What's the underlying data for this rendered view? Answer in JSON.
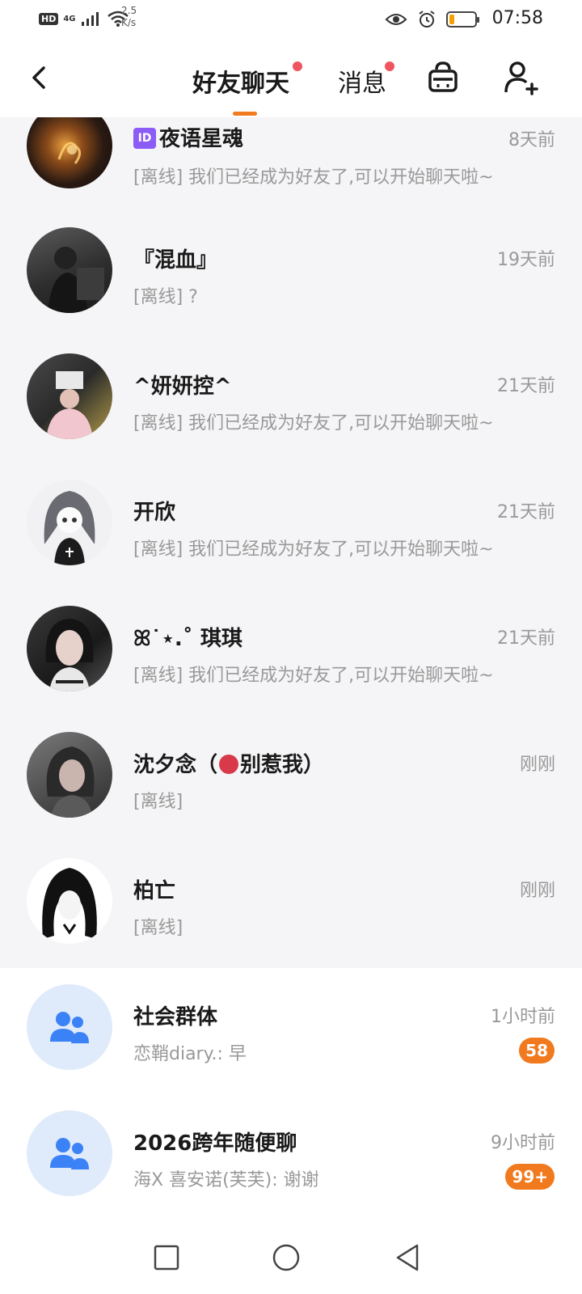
{
  "status_bar": {
    "hd": "HD",
    "network": "4G",
    "speed_value": "2.5",
    "speed_unit": "K/s",
    "battery_level": 0.2,
    "time": "07:58"
  },
  "header": {
    "tabs": [
      {
        "label": "好友聊天",
        "active": true,
        "has_dot": true
      },
      {
        "label": "消息",
        "active": false,
        "has_dot": true
      }
    ],
    "icons": [
      "back-icon",
      "shop-bag-icon",
      "add-friend-icon"
    ],
    "accent_color": "#f07a1d",
    "dot_color": "#f0545e"
  },
  "friends": [
    {
      "name": "夜语星魂",
      "name_prefix": "ID",
      "time": "8天前",
      "preview": "[离线] 我们已经成为好友了,可以开始聊天啦~"
    },
    {
      "name": "『混血』",
      "time": "19天前",
      "preview": "[离线] ?"
    },
    {
      "name": "^妍妍控^",
      "time": "21天前",
      "preview": "[离线] 我们已经成为好友了,可以开始聊天啦~"
    },
    {
      "name": "开欣",
      "time": "21天前",
      "preview": "[离线] 我们已经成为好友了,可以开始聊天啦~"
    },
    {
      "name": "ꕤ˙⋆.˚  琪琪",
      "time": "21天前",
      "preview": "[离线] 我们已经成为好友了,可以开始聊天啦~"
    },
    {
      "name_before": "沈夕念（",
      "name_after": "别惹我）",
      "emoji": "angry-face-icon",
      "time": "刚刚",
      "preview": "[离线]"
    },
    {
      "name": "柏亡",
      "time": "刚刚",
      "preview": "[离线]"
    }
  ],
  "groups": [
    {
      "name": "社会群体",
      "time": "1小时前",
      "preview": "恋鞘diary.: 早",
      "badge": "58"
    },
    {
      "name": "2026跨年随便聊",
      "time": "9小时前",
      "preview": "海X 喜安诺(芙芙): 谢谢",
      "badge": "99+"
    }
  ],
  "nav": [
    "recents-square-icon",
    "home-circle-icon",
    "back-triangle-icon"
  ]
}
